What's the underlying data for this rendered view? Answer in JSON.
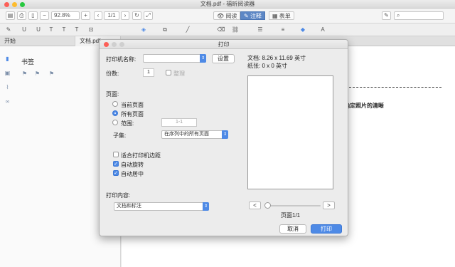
{
  "window": {
    "title": "文档.pdf - 福昕阅读器"
  },
  "toolbar": {
    "zoom": "92.8%",
    "page": "1/1",
    "modes": [
      "阅读",
      "注释",
      "表单"
    ],
    "active_mode": "注释"
  },
  "tabs": [
    "开始",
    "文档.pdf"
  ],
  "sidebar": {
    "bookmarks_title": "书签"
  },
  "document": {
    "text": "必确定照片的清晰"
  },
  "dialog": {
    "title": "打印",
    "printer_label": "打印机名称:",
    "setup_button": "设置",
    "copies_label": "份数:",
    "copies_value": "1",
    "collate_label": "整理",
    "pages_label": "页面:",
    "page_options": [
      "当前页面",
      "所有页面",
      "范围:"
    ],
    "selected_page_option": "所有页面",
    "range_value": "1-1",
    "subset_label": "子集:",
    "subset_value": "在序列中的所有页面",
    "options": [
      {
        "label": "适合打印机边距",
        "checked": false
      },
      {
        "label": "自动旋转",
        "checked": true
      },
      {
        "label": "自动居中",
        "checked": true
      }
    ],
    "content_label": "打印内容:",
    "content_value": "文档和标注",
    "doc_size": "文档: 8.26 x 11.69 英寸",
    "paper_size": "纸张: 0 x 0 英寸",
    "prev_label": "<",
    "next_label": ">",
    "page_indicator": "页面1/1",
    "cancel_button": "取消",
    "print_button": "打印"
  },
  "colors": {
    "accent": "#4e8ae6",
    "mode_active": "#5d87c5"
  }
}
